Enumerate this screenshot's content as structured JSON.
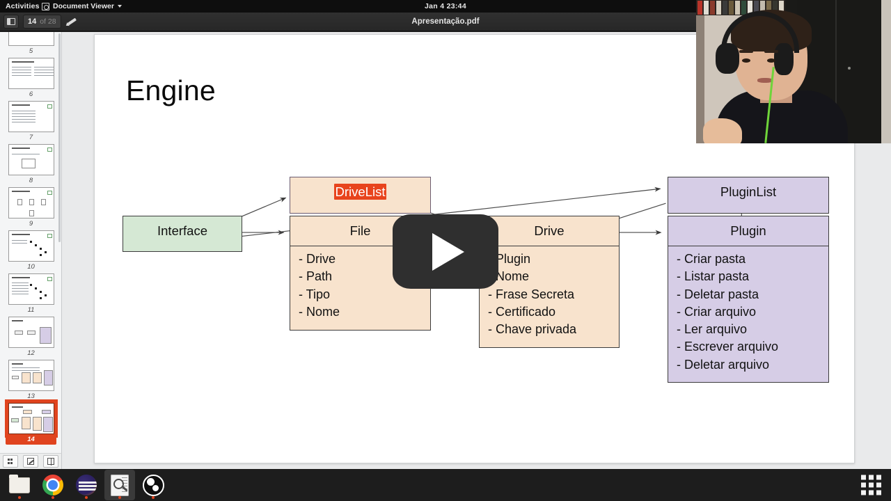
{
  "topbar": {
    "activities": "Activities",
    "app_name": "Document Viewer",
    "app_icon": "document-viewer-icon",
    "menu_caret": "chevron-down-icon",
    "clock": "Jan 4  23:44"
  },
  "headerbar": {
    "sidebar_toggle_icon": "sidebar-toggle-icon",
    "current_page": "14",
    "page_total": "of 28",
    "annotate_icon": "pencil-icon",
    "title": "Apresentação.pdf"
  },
  "thumbnails": {
    "scrollbar": "thumbnail-scrollbar",
    "items": [
      {
        "number": "5",
        "selected": false
      },
      {
        "number": "6",
        "selected": false
      },
      {
        "number": "7",
        "selected": false
      },
      {
        "number": "8",
        "selected": false
      },
      {
        "number": "9",
        "selected": false
      },
      {
        "number": "10",
        "selected": false
      },
      {
        "number": "11",
        "selected": false
      },
      {
        "number": "12",
        "selected": false
      },
      {
        "number": "13",
        "selected": false
      },
      {
        "number": "14",
        "selected": true
      }
    ],
    "toolbar": {
      "thumbnails_icon": "grid-icon",
      "annotations_icon": "annotations-icon",
      "outline_icon": "outline-icon"
    }
  },
  "slide": {
    "title": "Engine",
    "colors": {
      "orange_fill": "#f8e3cd",
      "purple_fill": "#d6cde6",
      "green_fill": "#d5e8d4",
      "border": "#3b3b3b",
      "violet_border": "#6b5b70",
      "selection": "#e8441d"
    },
    "boxes": {
      "interface": {
        "title": "Interface",
        "items": []
      },
      "drivelist": {
        "title": "DriveList",
        "items": [],
        "selected": true
      },
      "file": {
        "title": "File",
        "items": [
          "- Drive",
          "- Path",
          "- Tipo",
          "- Nome"
        ]
      },
      "drive": {
        "title": "Drive",
        "items": [
          "- Plugin",
          "- Nome",
          "- Frase Secreta",
          "- Certificado",
          "- Chave privada"
        ]
      },
      "pluginlist": {
        "title": "PluginList",
        "items": []
      },
      "plugin": {
        "title": "Plugin",
        "items": [
          "- Criar pasta",
          "- Listar pasta",
          "- Deletar pasta",
          "- Criar arquivo",
          "- Ler arquivo",
          "- Escrever arquivo",
          "- Deletar arquivo"
        ]
      }
    },
    "edges": [
      {
        "from": "interface",
        "to": "drivelist"
      },
      {
        "from": "interface",
        "to": "file"
      },
      {
        "from": "drivelist",
        "to": "drive"
      },
      {
        "from": "file",
        "to": "drive"
      },
      {
        "from": "pluginlist",
        "to": "drive"
      },
      {
        "from": "drive",
        "to": "plugin"
      },
      {
        "from": "pluginlist",
        "to": "plugin"
      },
      {
        "from": "interface",
        "to": "pluginlist"
      }
    ]
  },
  "overlays": {
    "play_button": "play-button-icon",
    "webcam": "webcam-overlay"
  },
  "dash": {
    "items": [
      {
        "name": "files",
        "icon": "folder-icon",
        "running": true,
        "active": false
      },
      {
        "name": "chrome",
        "icon": "chrome-icon",
        "running": true,
        "active": false
      },
      {
        "name": "firefox",
        "icon": "browser-icon",
        "running": true,
        "active": false
      },
      {
        "name": "evince",
        "icon": "document-viewer-icon",
        "running": true,
        "active": true
      },
      {
        "name": "obs",
        "icon": "obs-icon",
        "running": true,
        "active": false
      }
    ],
    "app_grid_icon": "app-grid-icon"
  }
}
